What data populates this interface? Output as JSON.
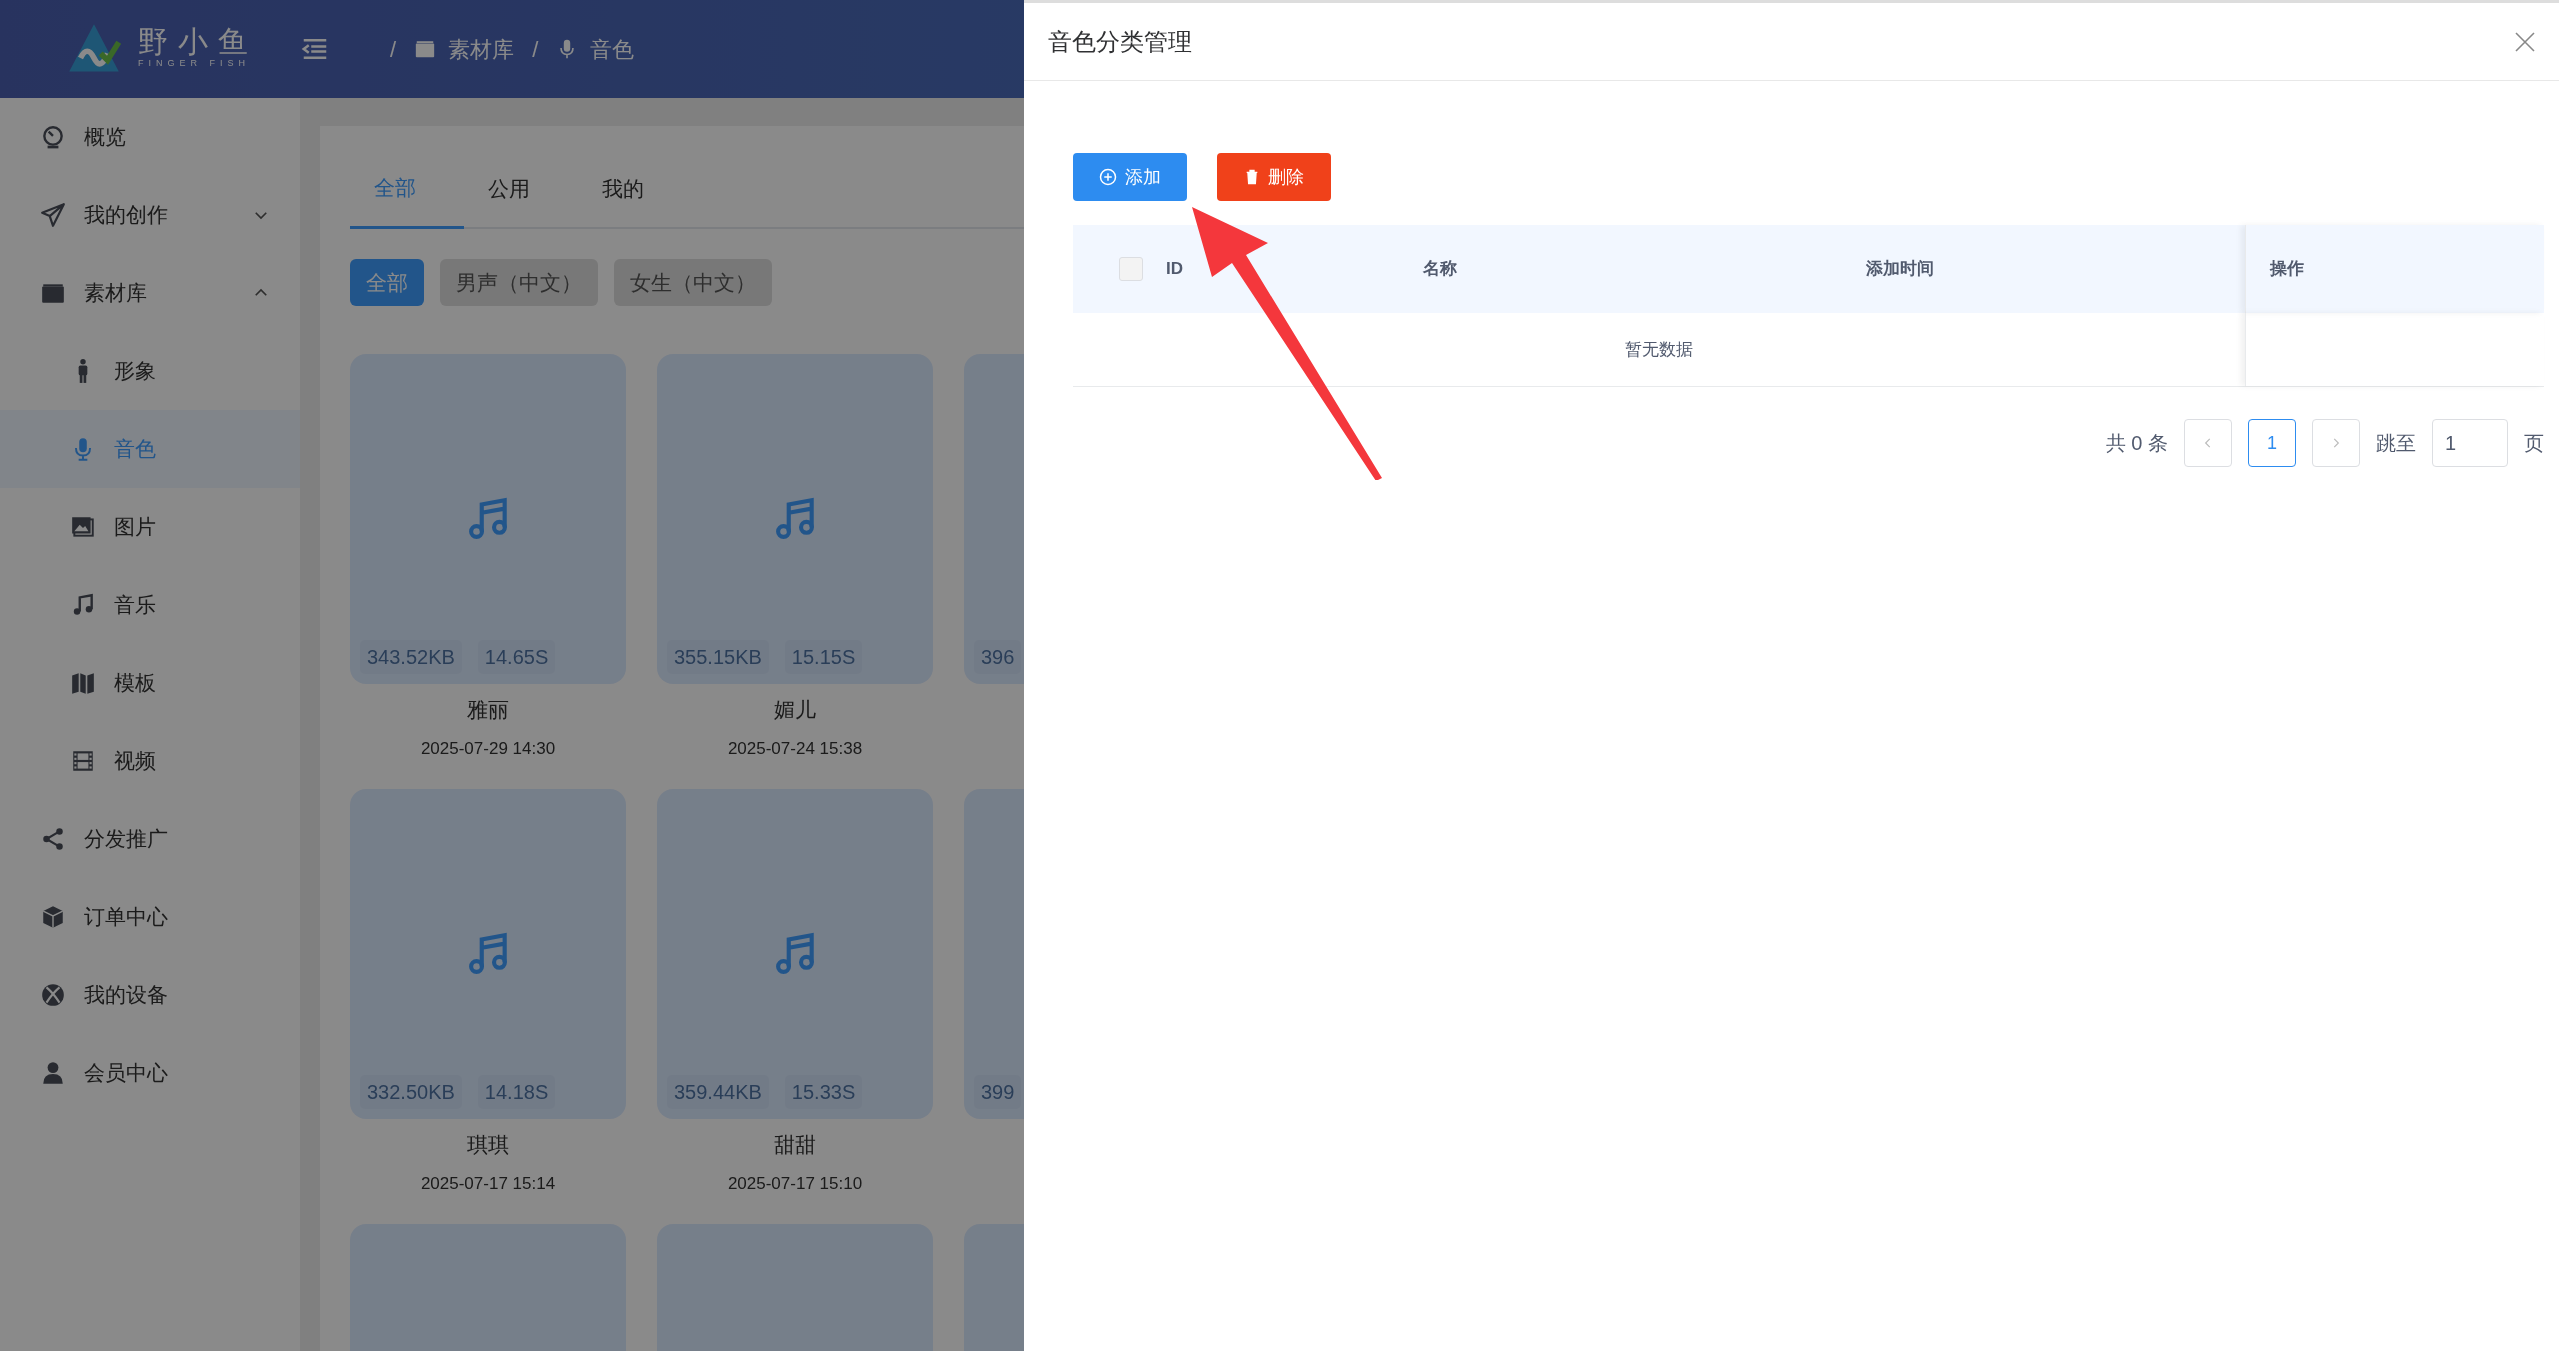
{
  "header": {
    "logo": {
      "name": "野小鱼",
      "subtitle": "FINGER FISH"
    },
    "breadcrumb": [
      {
        "separator": "/",
        "label": "素材库"
      },
      {
        "separator": "/",
        "label": "音色"
      }
    ]
  },
  "sidebar": {
    "items": [
      {
        "label": "概览",
        "selected": false
      },
      {
        "label": "我的创作",
        "selected": false,
        "expanded": false
      },
      {
        "label": "素材库",
        "selected": false,
        "expanded": true,
        "children": [
          {
            "label": "形象",
            "selected": false
          },
          {
            "label": "音色",
            "selected": true
          },
          {
            "label": "图片",
            "selected": false
          },
          {
            "label": "音乐",
            "selected": false
          },
          {
            "label": "模板",
            "selected": false
          },
          {
            "label": "视频",
            "selected": false
          }
        ]
      },
      {
        "label": "分发推广",
        "selected": false
      },
      {
        "label": "订单中心",
        "selected": false
      },
      {
        "label": "我的设备",
        "selected": false
      },
      {
        "label": "会员中心",
        "selected": false
      }
    ]
  },
  "tabs": [
    {
      "label": "全部",
      "selected": true
    },
    {
      "label": "公用",
      "selected": false
    },
    {
      "label": "我的",
      "selected": false
    }
  ],
  "filters": [
    {
      "label": "全部",
      "selected": true
    },
    {
      "label": "男声（中文）",
      "selected": false
    },
    {
      "label": "女生（中文）",
      "selected": false
    }
  ],
  "cards": [
    {
      "size": "343.52KB",
      "duration": "14.65S",
      "name": "雅丽",
      "date": "2025-07-29 14:30"
    },
    {
      "size": "355.15KB",
      "duration": "15.15S",
      "name": "媚儿",
      "date": "2025-07-24 15:38"
    },
    {
      "size": "396"
    },
    {
      "size": "332.50KB",
      "duration": "14.18S",
      "name": "琪琪",
      "date": "2025-07-17 15:14"
    },
    {
      "size": "359.44KB",
      "duration": "15.33S",
      "name": "甜甜",
      "date": "2025-07-17 15:10"
    },
    {
      "size": "399"
    }
  ],
  "drawer": {
    "title": "音色分类管理",
    "buttons": [
      {
        "label": "添加",
        "kind": "add"
      },
      {
        "label": "删除",
        "kind": "delete"
      }
    ],
    "table": {
      "select_all": {
        "checked": false
      },
      "columns": [
        "ID",
        "名称",
        "添加时间",
        "操作"
      ],
      "empty_text": "暂无数据"
    },
    "pagination": {
      "total": "共 0 条",
      "pages": [
        {
          "label": "1",
          "selected": true
        }
      ],
      "jump_label": "跳至",
      "jump_value": "1",
      "suffix": "页"
    }
  }
}
